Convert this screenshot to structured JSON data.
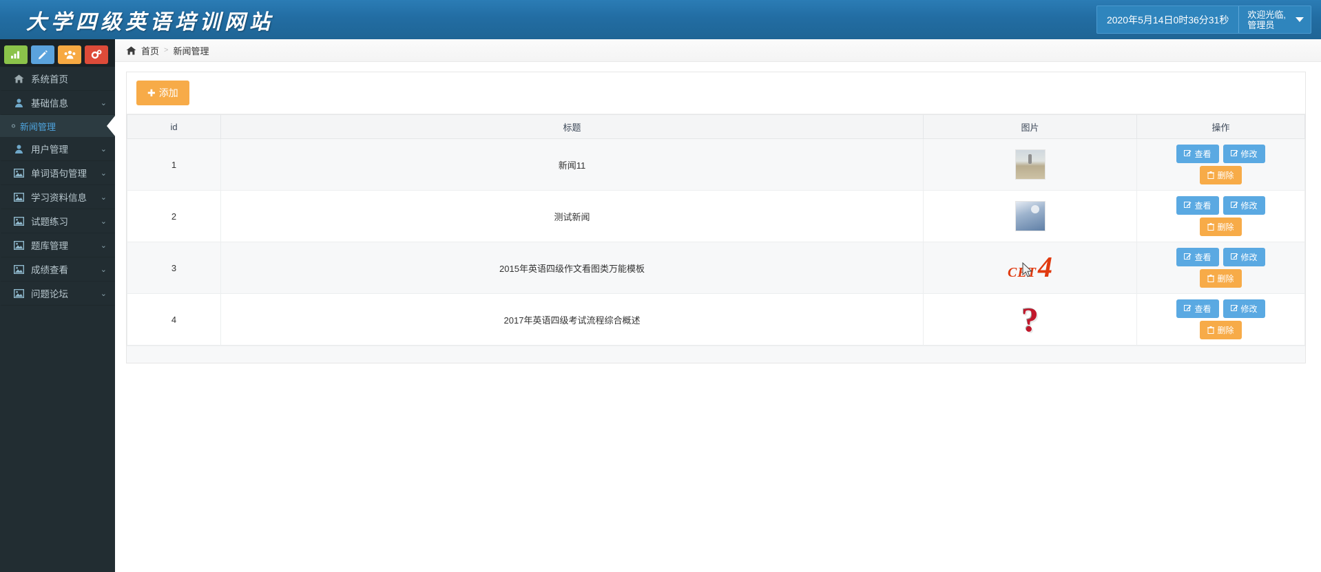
{
  "topbar": {
    "brand": "大学四级英语培训网站",
    "clock": "2020年5月14日0时36分31秒",
    "user_greeting": "欢迎光临,\n管理员",
    "caret_icon": "chevron-down-icon"
  },
  "sidebar": {
    "quick_icons": [
      {
        "name": "bar-chart-icon",
        "color": "#8bc34a"
      },
      {
        "name": "pencil-icon",
        "color": "#5ba3dd"
      },
      {
        "name": "users-icon",
        "color": "#f7a942"
      },
      {
        "name": "gears-icon",
        "color": "#dd4b39"
      }
    ],
    "items": [
      {
        "label": "系统首页",
        "icon": "home-icon",
        "has_chevron": false
      },
      {
        "label": "基础信息",
        "icon": "user-icon",
        "has_chevron": true
      },
      {
        "label": "新闻管理",
        "icon": "dot-icon",
        "has_chevron": false,
        "active": true,
        "sub": true
      },
      {
        "label": "用户管理",
        "icon": "user-icon",
        "has_chevron": true
      },
      {
        "label": "单词语句管理",
        "icon": "image-icon",
        "has_chevron": true
      },
      {
        "label": "学习资料信息",
        "icon": "image-icon",
        "has_chevron": true
      },
      {
        "label": "试题练习",
        "icon": "image-icon",
        "has_chevron": true
      },
      {
        "label": "题库管理",
        "icon": "image-icon",
        "has_chevron": true
      },
      {
        "label": "成绩查看",
        "icon": "image-icon",
        "has_chevron": true
      },
      {
        "label": "问题论坛",
        "icon": "image-icon",
        "has_chevron": true
      }
    ]
  },
  "breadcrumb": {
    "home_icon": "home-icon",
    "root": "首页",
    "separator": ">",
    "current": "新闻管理"
  },
  "toolbar": {
    "add_label": "添加",
    "add_plus": "✚"
  },
  "table": {
    "headers": [
      "id",
      "标题",
      "图片",
      "操作"
    ],
    "rows": [
      {
        "id": "1",
        "title": "新闻11",
        "image": "beach-photo-thumbnail",
        "actions": [
          "查看",
          "修改",
          "删除"
        ]
      },
      {
        "id": "2",
        "title": "测试新闻",
        "image": "blue-photo-thumbnail",
        "actions": [
          "查看",
          "修改",
          "删除"
        ]
      },
      {
        "id": "3",
        "title": "2015年英语四级作文看图类万能模板",
        "image": "cet4-logo",
        "image_text_primary": "CET",
        "image_text_secondary": "4",
        "actions": [
          "查看",
          "修改",
          "删除"
        ]
      },
      {
        "id": "4",
        "title": "2017年英语四级考试流程综合概述",
        "image": "red-question-mark",
        "image_text_primary": "?",
        "actions": [
          "查看",
          "修改",
          "删除"
        ]
      }
    ],
    "action_labels": {
      "view": "查看",
      "edit": "修改",
      "delete": "删除"
    }
  },
  "colors": {
    "topbar": "#226da3",
    "sidebar": "#222d32",
    "accent_orange": "#f7ab48",
    "accent_blue": "#5aa9e2",
    "active_sub": "#2c3b41"
  }
}
